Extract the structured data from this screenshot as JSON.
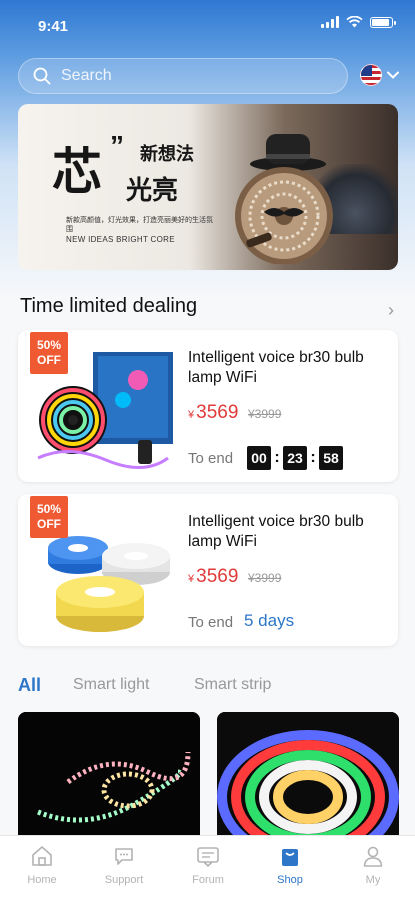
{
  "status_bar": {
    "time": "9:41"
  },
  "search": {
    "placeholder": "Search"
  },
  "banner": {
    "headline_big": "芯",
    "headline_quote": "”",
    "headline_small": "新想法",
    "headline_sub": "光亮",
    "fine_print": "新款高颜值，灯光效果，打造亮丽美好的生活氛围",
    "slogan": "NEW IDEAS BRIGHT CORE"
  },
  "deals_section": {
    "title": "Time limited dealing",
    "more": "›"
  },
  "deals": [
    {
      "badge_pct": "50%",
      "badge_off": "OFF",
      "name": "Intelligent voice br30 bulb lamp WiFi",
      "currency": "¥",
      "price": "3569",
      "original_price": "¥3999",
      "to_end_label": "To end",
      "timer": {
        "hours": "00",
        "minutes": "23",
        "seconds": "58"
      }
    },
    {
      "badge_pct": "50%",
      "badge_off": "OFF",
      "name": "Intelligent voice br30 bulb lamp WiFi",
      "currency": "¥",
      "price": "3569",
      "original_price": "¥3999",
      "to_end_label": "To end",
      "days": "5 days"
    }
  ],
  "tabs": [
    {
      "label": "All",
      "active": true
    },
    {
      "label": "Smart light",
      "active": false
    },
    {
      "label": "Smart strip",
      "active": false
    }
  ],
  "bottom_nav": [
    {
      "label": "Home",
      "icon": "home-icon",
      "active": false
    },
    {
      "label": "Support",
      "icon": "chat-icon",
      "active": false
    },
    {
      "label": "Forum",
      "icon": "forum-icon",
      "active": false
    },
    {
      "label": "Shop",
      "icon": "bag-icon",
      "active": true
    },
    {
      "label": "My",
      "icon": "user-icon",
      "active": false
    }
  ],
  "colors": {
    "accent": "#2d76c8",
    "sale_red": "#e03a3a",
    "badge_orange": "#f05a33"
  }
}
